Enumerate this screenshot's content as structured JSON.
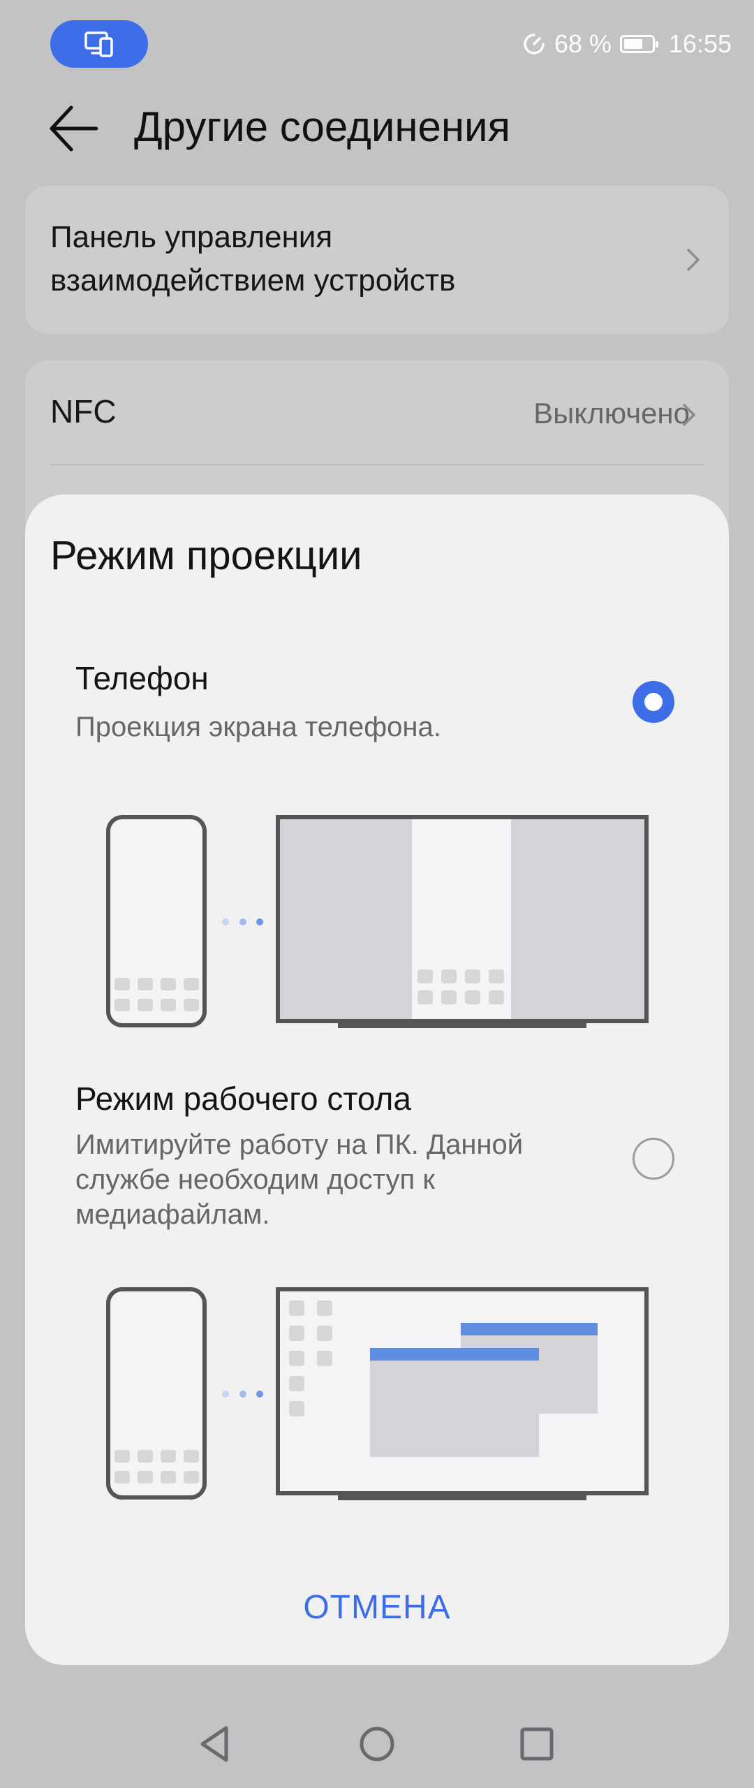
{
  "status_bar": {
    "battery_percent": "68 %",
    "battery_level": 0.68,
    "time": "16:55",
    "pill_icon": "device-cast-icon",
    "speed_icon": "data-saver-icon",
    "colors": {
      "pill": "#3d6ee8"
    }
  },
  "header": {
    "back_icon": "arrow-left-icon",
    "title": "Другие соединения"
  },
  "settings": {
    "device_panel": {
      "line1": "Панель управления",
      "line2": "взаимодействием устройств"
    },
    "nfc": {
      "label": "NFC",
      "value": "Выключено"
    }
  },
  "dialog": {
    "title": "Режим проекции",
    "options": [
      {
        "title": "Телефон",
        "description": "Проекция экрана телефона.",
        "selected": true
      },
      {
        "title": "Режим рабочего стола",
        "description_lines": [
          "Имитируйте работу на ПК. Данной",
          "службе необходим доступ к",
          "медиафайлам."
        ],
        "selected": false
      }
    ],
    "cancel_label": "ОТМЕНА"
  },
  "nav_bar": {
    "back_icon": "triangle-back-icon",
    "home_icon": "circle-home-icon",
    "recents_icon": "square-recents-icon"
  },
  "colors": {
    "accent": "#3d6ee8",
    "background": "#c3c3c6",
    "dialog": "#f1f1f2"
  }
}
